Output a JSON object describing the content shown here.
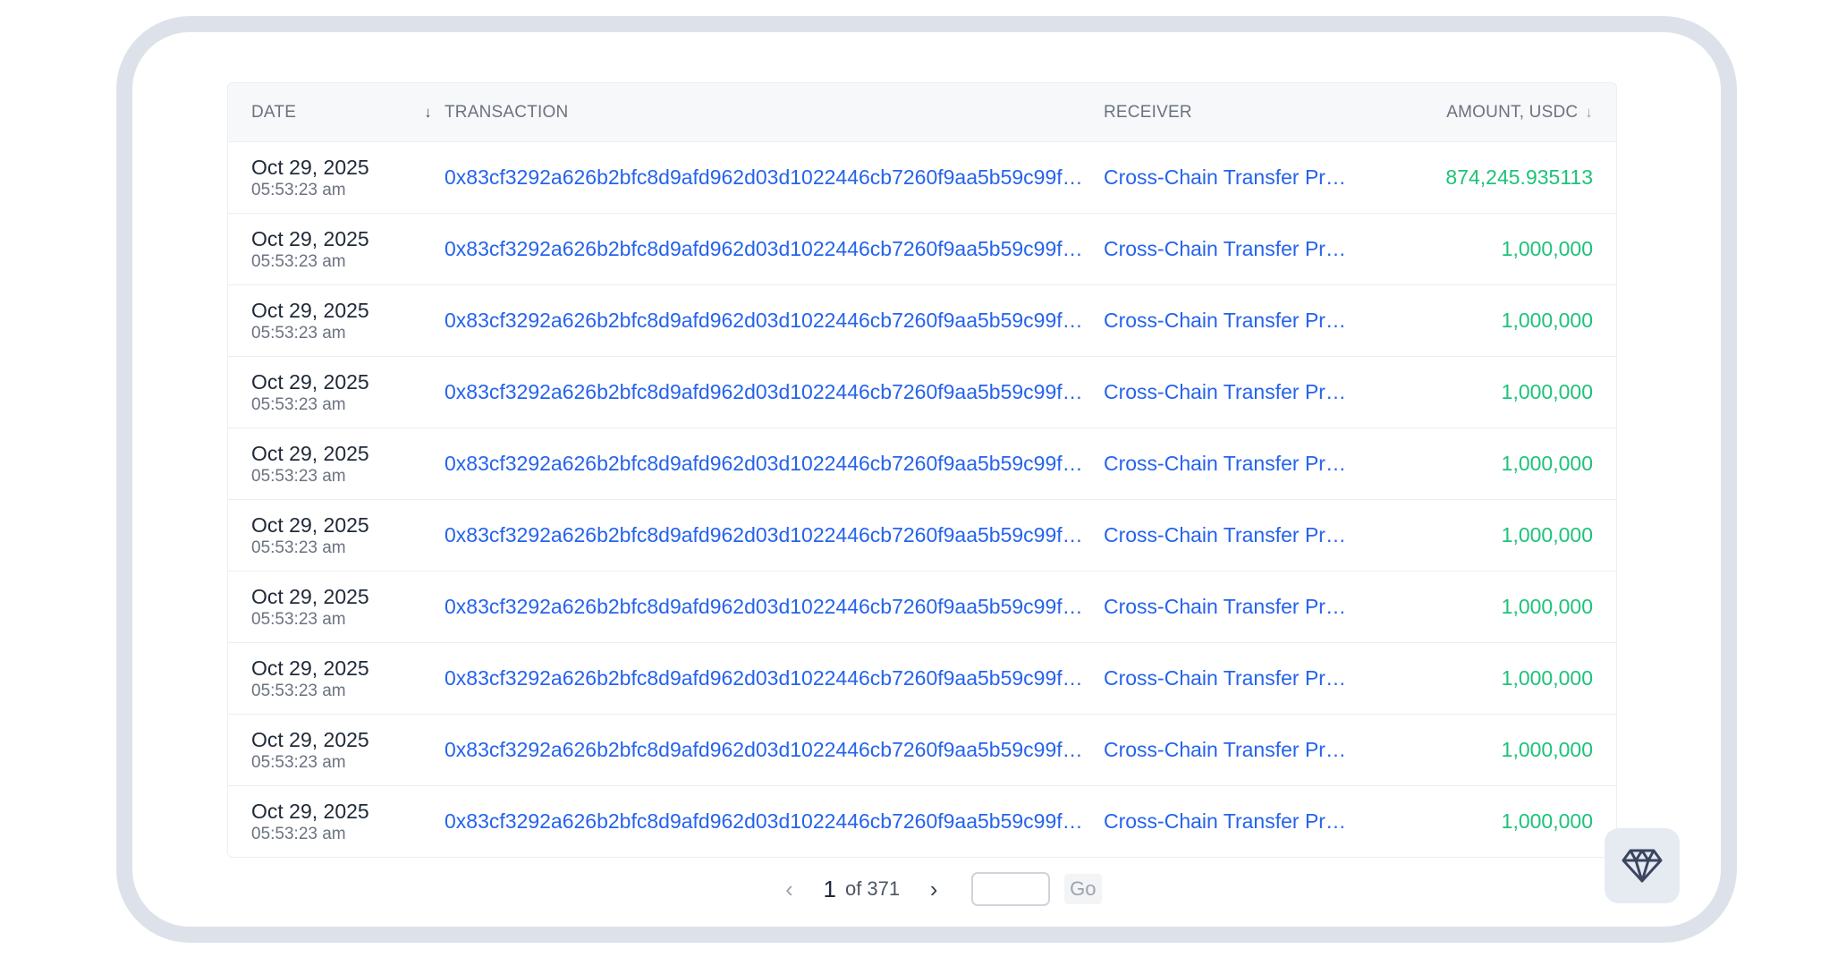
{
  "table": {
    "columns": {
      "date": "DATE",
      "transaction": "TRANSACTION",
      "receiver": "RECEIVER",
      "amount": "AMOUNT, USDC"
    },
    "rows": [
      {
        "date": "Oct 29, 2025",
        "time": "05:53:23 am",
        "tx": "0x83cf3292a626b2bfc8d9afd962d03d1022446cb7260f9aa5b59c99f…",
        "receiver": "Cross-Chain Transfer Pr…",
        "amount": "874,245.935113"
      },
      {
        "date": "Oct 29, 2025",
        "time": "05:53:23 am",
        "tx": "0x83cf3292a626b2bfc8d9afd962d03d1022446cb7260f9aa5b59c99f…",
        "receiver": "Cross-Chain Transfer Pr…",
        "amount": "1,000,000"
      },
      {
        "date": "Oct 29, 2025",
        "time": "05:53:23 am",
        "tx": "0x83cf3292a626b2bfc8d9afd962d03d1022446cb7260f9aa5b59c99f…",
        "receiver": "Cross-Chain Transfer Pr…",
        "amount": "1,000,000"
      },
      {
        "date": "Oct 29, 2025",
        "time": "05:53:23 am",
        "tx": "0x83cf3292a626b2bfc8d9afd962d03d1022446cb7260f9aa5b59c99f…",
        "receiver": "Cross-Chain Transfer Pr…",
        "amount": "1,000,000"
      },
      {
        "date": "Oct 29, 2025",
        "time": "05:53:23 am",
        "tx": "0x83cf3292a626b2bfc8d9afd962d03d1022446cb7260f9aa5b59c99f…",
        "receiver": "Cross-Chain Transfer Pr…",
        "amount": "1,000,000"
      },
      {
        "date": "Oct 29, 2025",
        "time": "05:53:23 am",
        "tx": "0x83cf3292a626b2bfc8d9afd962d03d1022446cb7260f9aa5b59c99f…",
        "receiver": "Cross-Chain Transfer Pr…",
        "amount": "1,000,000"
      },
      {
        "date": "Oct 29, 2025",
        "time": "05:53:23 am",
        "tx": "0x83cf3292a626b2bfc8d9afd962d03d1022446cb7260f9aa5b59c99f…",
        "receiver": "Cross-Chain Transfer Pr…",
        "amount": "1,000,000"
      },
      {
        "date": "Oct 29, 2025",
        "time": "05:53:23 am",
        "tx": "0x83cf3292a626b2bfc8d9afd962d03d1022446cb7260f9aa5b59c99f…",
        "receiver": "Cross-Chain Transfer Pr…",
        "amount": "1,000,000"
      },
      {
        "date": "Oct 29, 2025",
        "time": "05:53:23 am",
        "tx": "0x83cf3292a626b2bfc8d9afd962d03d1022446cb7260f9aa5b59c99f…",
        "receiver": "Cross-Chain Transfer Pr…",
        "amount": "1,000,000"
      },
      {
        "date": "Oct 29, 2025",
        "time": "05:53:23 am",
        "tx": "0x83cf3292a626b2bfc8d9afd962d03d1022446cb7260f9aa5b59c99f…",
        "receiver": "Cross-Chain Transfer Pr…",
        "amount": "1,000,000"
      }
    ]
  },
  "pagination": {
    "current_page": "1",
    "of_label": "of 371",
    "go_label": "Go",
    "input_value": ""
  },
  "icons": {
    "sort": "arrow-down-icon",
    "prev": "chevron-left-icon",
    "next": "chevron-right-icon",
    "gem": "diamond-icon"
  },
  "colors": {
    "link": "#2563eb",
    "amount": "#1ec27a",
    "frame": "#dde2ea"
  }
}
